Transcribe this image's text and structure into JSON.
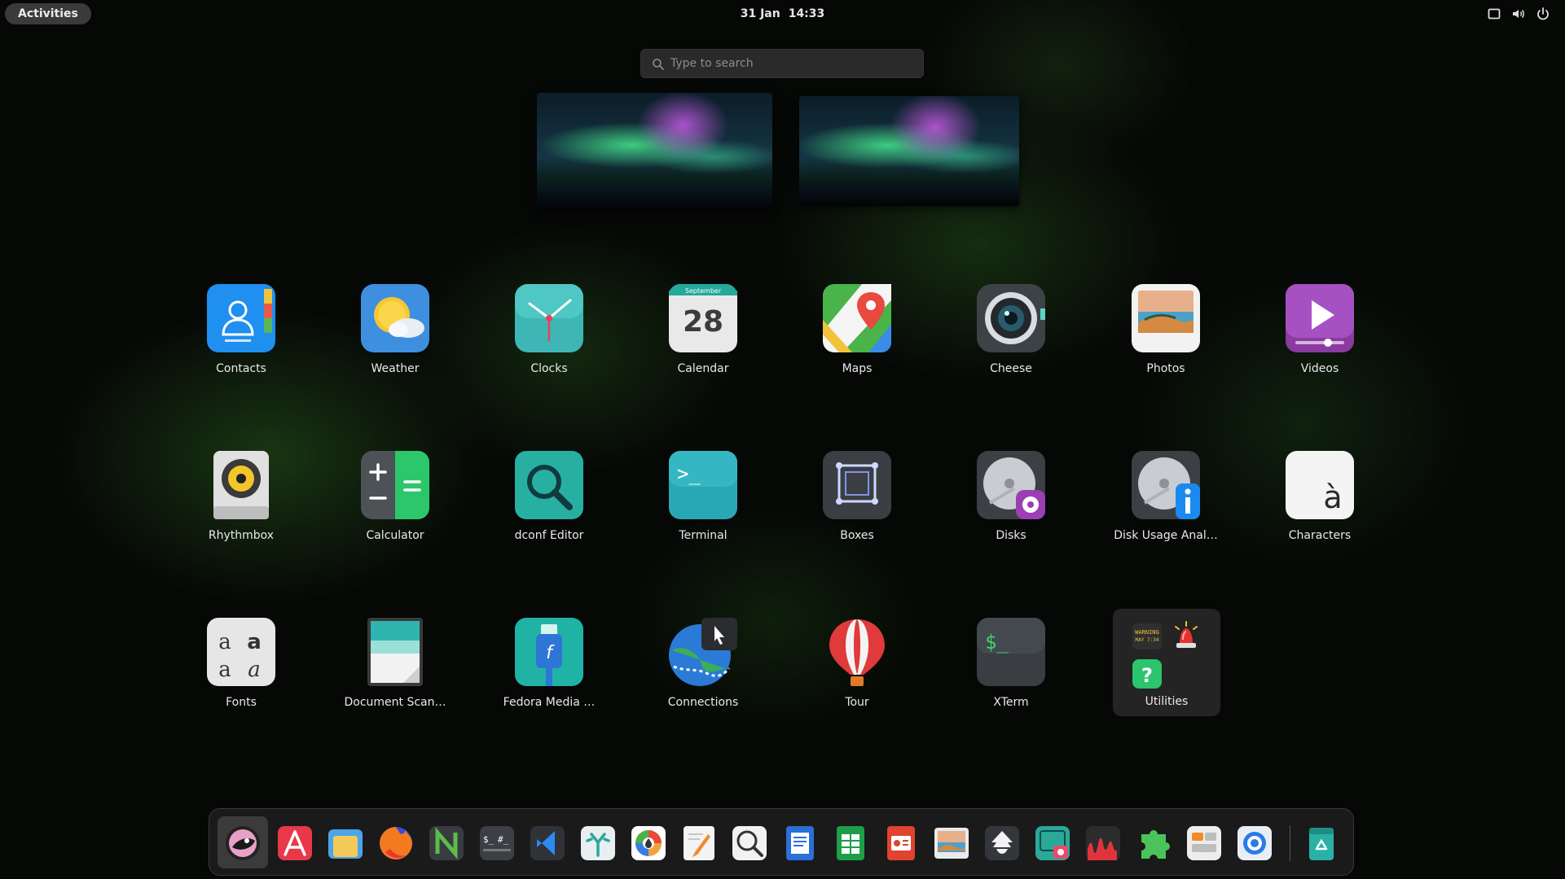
{
  "topbar": {
    "activities_label": "Activities",
    "date": "31 Jan",
    "time": "14:33"
  },
  "search": {
    "placeholder": "Type to search"
  },
  "workspaces": [
    {
      "name": "workspace-1"
    },
    {
      "name": "workspace-2"
    }
  ],
  "apps": [
    "Contacts",
    "Weather",
    "Clocks",
    "Calendar",
    "Maps",
    "Cheese",
    "Photos",
    "Videos",
    "Rhythmbox",
    "Calculator",
    "dconf Editor",
    "Terminal",
    "Boxes",
    "Disks",
    "Disk Usage Anal…",
    "Characters",
    "Fonts",
    "Document Scan…",
    "Fedora Media …",
    "Connections",
    "Tour",
    "XTerm"
  ],
  "calendar_icon": {
    "month": "September",
    "day": "28"
  },
  "characters_icon": {
    "glyph": "à"
  },
  "fonts_icon": {
    "glyph_a": "a",
    "glyph_A": "a"
  },
  "terminal_icon": {
    "prompt": ">_"
  },
  "xterm_icon": {
    "prompt": "$_"
  },
  "folder": {
    "label": "Utilities",
    "mini_icons": [
      "log-warning-icon",
      "alarm-light-icon",
      "help-icon"
    ],
    "warning_text": "WARNING",
    "warning_sub": "MAY 7:34"
  },
  "dock": {
    "items": [
      "mastodon-client-icon",
      "software-store-icon",
      "files-icon",
      "firefox-icon",
      "neovim-icon",
      "terminal-prompts-icon",
      "vscode-icon",
      "coral-app-icon",
      "color-picker-icon",
      "text-editor-icon",
      "image-viewer-icon",
      "writer-document-icon",
      "spreadsheet-icon",
      "presentation-icon",
      "photos-preview-icon",
      "inkscape-icon",
      "screenshot-icon",
      "audio-waveform-icon",
      "extensions-icon",
      "tweaks-icon",
      "settings-icon",
      "recycle-bin-icon"
    ]
  },
  "colors": {
    "accent_blue": "#2a8bf2",
    "panel_bg": "#2a2a2a",
    "dock_bg": "#1c1c1c",
    "background": "#060806"
  }
}
